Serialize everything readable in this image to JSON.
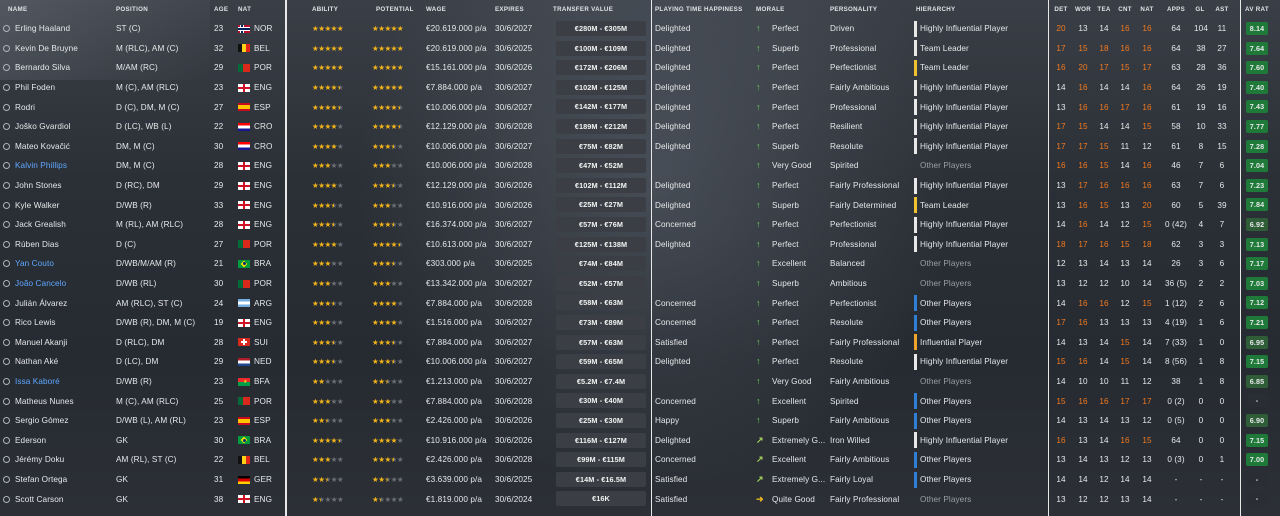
{
  "headers": {
    "name": "NAME",
    "position": "POSITION",
    "age": "AGE",
    "nat": "NAT",
    "ability": "ABILITY",
    "potential": "POTENTIAL",
    "wage": "WAGE",
    "expires": "EXPIRES",
    "transfer_value": "TRANSFER VALUE",
    "pt_happiness": "PLAYING TIME HAPPINESS",
    "morale": "MORALE",
    "personality": "PERSONALITY",
    "hierarchy": "HIERARCHY",
    "det": "DET",
    "wor": "WOR",
    "tea": "TEA",
    "cnt": "CNT",
    "natc": "NAT",
    "apps": "APPS",
    "gl": "GL",
    "ast": "AST",
    "avrat": "AV RAT"
  },
  "colors": {
    "star": "#f0b31a",
    "high_attr": "#f3791d",
    "link": "#5fa8ff",
    "hierarchy_white": "#e8e8e8",
    "hierarchy_yellow": "#f2c12e",
    "hierarchy_orange": "#f0a52a",
    "hierarchy_blue": "#2f7fd6",
    "rat_high": "#1f7a3a",
    "rat_mid": "#2f5d38"
  },
  "rows": [
    {
      "name": "Erling Haaland",
      "pos": "ST (C)",
      "age": "23",
      "flag": "NOR",
      "nat": "NOR",
      "ab": 5,
      "po": 5,
      "wage": "€20.619.000 p/a",
      "exp": "30/6/2027",
      "tv": "€280M - €305M",
      "pt": "Delighted",
      "mor": "Perfect",
      "mi": "up",
      "pers": "Driven",
      "hb": "white",
      "hier": "Highly Influential Player",
      "det": "20",
      "wor": "13",
      "tea": "14",
      "cnt": "16",
      "natc": "16",
      "apps": "64",
      "gl": "104",
      "ast": "11",
      "rat": "8.14"
    },
    {
      "name": "Kevin De Bruyne",
      "pos": "M (RLC), AM (C)",
      "age": "32",
      "flag": "BEL",
      "nat": "BEL",
      "ab": 5,
      "po": 5,
      "wage": "€20.619.000 p/a",
      "exp": "30/6/2025",
      "tv": "€100M - €109M",
      "pt": "Delighted",
      "mor": "Superb",
      "mi": "up",
      "pers": "Professional",
      "hb": "white",
      "hier": "Team Leader",
      "det": "17",
      "wor": "15",
      "tea": "18",
      "cnt": "16",
      "natc": "16",
      "apps": "64",
      "gl": "38",
      "ast": "27",
      "rat": "7.64"
    },
    {
      "name": "Bernardo Silva",
      "pos": "M/AM (RC)",
      "age": "29",
      "flag": "POR",
      "nat": "POR",
      "ab": 5,
      "po": 5,
      "wage": "€15.161.000 p/a",
      "exp": "30/6/2026",
      "tv": "€172M - €206M",
      "pt": "Delighted",
      "mor": "Perfect",
      "mi": "up",
      "pers": "Perfectionist",
      "hb": "yellow",
      "hier": "Team Leader",
      "det": "16",
      "wor": "20",
      "tea": "17",
      "cnt": "15",
      "natc": "17",
      "apps": "63",
      "gl": "28",
      "ast": "36",
      "rat": "7.60"
    },
    {
      "name": "Phil Foden",
      "pos": "M (C), AM (RLC)",
      "age": "23",
      "flag": "ENG",
      "nat": "ENG",
      "ab": 4.5,
      "po": 5,
      "wage": "€7.884.000 p/a",
      "exp": "30/6/2027",
      "tv": "€102M - €125M",
      "pt": "Delighted",
      "mor": "Perfect",
      "mi": "up",
      "pers": "Fairly Ambitious",
      "hb": "white",
      "hier": "Highly Influential Player",
      "det": "14",
      "wor": "16",
      "tea": "14",
      "cnt": "14",
      "natc": "16",
      "apps": "64",
      "gl": "26",
      "ast": "19",
      "rat": "7.40"
    },
    {
      "name": "Rodri",
      "pos": "D (C), DM, M (C)",
      "age": "27",
      "flag": "ESP",
      "nat": "ESP",
      "ab": 4.5,
      "po": 4.5,
      "wage": "€10.006.000 p/a",
      "exp": "30/6/2027",
      "tv": "€142M - €177M",
      "pt": "Delighted",
      "mor": "Perfect",
      "mi": "up",
      "pers": "Professional",
      "hb": "white",
      "hier": "Highly Influential Player",
      "det": "13",
      "wor": "16",
      "tea": "16",
      "cnt": "17",
      "natc": "16",
      "apps": "61",
      "gl": "19",
      "ast": "16",
      "rat": "7.43"
    },
    {
      "name": "Joško Gvardiol",
      "pos": "D (LC), WB (L)",
      "age": "22",
      "flag": "CRO",
      "nat": "CRO",
      "ab": 4,
      "po": 4.5,
      "wage": "€12.129.000 p/a",
      "exp": "30/6/2028",
      "tv": "€189M - €212M",
      "pt": "Delighted",
      "mor": "Perfect",
      "mi": "up",
      "pers": "Resilient",
      "hb": "white",
      "hier": "Highly Influential Player",
      "det": "17",
      "wor": "15",
      "tea": "14",
      "cnt": "14",
      "natc": "15",
      "apps": "58",
      "gl": "10",
      "ast": "33",
      "rat": "7.77"
    },
    {
      "name": "Mateo Kovačić",
      "pos": "DM, M (C)",
      "age": "30",
      "flag": "CRO",
      "nat": "CRO",
      "ab": 4,
      "po": 3.5,
      "wage": "€10.006.000 p/a",
      "exp": "30/6/2027",
      "tv": "€75M - €82M",
      "pt": "Delighted",
      "mor": "Superb",
      "mi": "up",
      "pers": "Resolute",
      "hb": "white",
      "hier": "Highly Influential Player",
      "det": "17",
      "wor": "17",
      "tea": "15",
      "cnt": "11",
      "natc": "12",
      "apps": "61",
      "gl": "8",
      "ast": "15",
      "rat": "7.28"
    },
    {
      "name": "Kalvin Phillips",
      "pos": "DM, M (C)",
      "age": "28",
      "flag": "ENG",
      "nat": "ENG",
      "link": true,
      "ab": 3,
      "po": 3,
      "wage": "€10.006.000 p/a",
      "exp": "30/6/2028",
      "tv": "€47M - €52M",
      "pt": "",
      "mor": "Very Good",
      "mi": "up",
      "pers": "Spirited",
      "hb": "",
      "hier": "Other Players",
      "dimh": true,
      "det": "16",
      "wor": "16",
      "tea": "15",
      "cnt": "14",
      "natc": "16",
      "apps": "46",
      "gl": "7",
      "ast": "6",
      "rat": "7.04"
    },
    {
      "name": "John Stones",
      "pos": "D (RC), DM",
      "age": "29",
      "flag": "ENG",
      "nat": "ENG",
      "ab": 4,
      "po": 3.5,
      "wage": "€12.129.000 p/a",
      "exp": "30/6/2026",
      "tv": "€102M - €112M",
      "pt": "Delighted",
      "mor": "Perfect",
      "mi": "up",
      "pers": "Fairly Professional",
      "hb": "white",
      "hier": "Highly Influential Player",
      "det": "13",
      "wor": "17",
      "tea": "16",
      "cnt": "16",
      "natc": "16",
      "apps": "63",
      "gl": "7",
      "ast": "6",
      "rat": "7.23"
    },
    {
      "name": "Kyle Walker",
      "pos": "D/WB (R)",
      "age": "33",
      "flag": "ENG",
      "nat": "ENG",
      "ab": 3.5,
      "po": 3,
      "wage": "€10.916.000 p/a",
      "exp": "30/6/2026",
      "tv": "€25M - €27M",
      "pt": "Delighted",
      "mor": "Superb",
      "mi": "up",
      "pers": "Fairly Determined",
      "hb": "yellow",
      "hier": "Team Leader",
      "det": "13",
      "wor": "16",
      "tea": "15",
      "cnt": "13",
      "natc": "20",
      "apps": "60",
      "gl": "5",
      "ast": "39",
      "rat": "7.84"
    },
    {
      "name": "Jack Grealish",
      "pos": "M (RL), AM (RLC)",
      "age": "28",
      "flag": "ENG",
      "nat": "ENG",
      "ab": 3.5,
      "po": 3.5,
      "wage": "€16.374.000 p/a",
      "exp": "30/6/2027",
      "tv": "€57M - €76M",
      "pt": "Concerned",
      "mor": "Perfect",
      "mi": "up",
      "pers": "Perfectionist",
      "hb": "white",
      "hier": "Highly Influential Player",
      "det": "14",
      "wor": "16",
      "tea": "14",
      "cnt": "12",
      "natc": "15",
      "apps": "0 (42)",
      "gl": "4",
      "ast": "7",
      "rat": "6.92"
    },
    {
      "name": "Rúben Dias",
      "pos": "D (C)",
      "age": "27",
      "flag": "POR",
      "nat": "POR",
      "ab": 4,
      "po": 4.5,
      "wage": "€10.613.000 p/a",
      "exp": "30/6/2027",
      "tv": "€125M - €138M",
      "pt": "Delighted",
      "mor": "Perfect",
      "mi": "up",
      "pers": "Professional",
      "hb": "white",
      "hier": "Highly Influential Player",
      "det": "18",
      "wor": "17",
      "tea": "16",
      "cnt": "15",
      "natc": "18",
      "apps": "62",
      "gl": "3",
      "ast": "3",
      "rat": "7.13"
    },
    {
      "name": "Yan Couto",
      "pos": "D/WB/M/AM (R)",
      "age": "21",
      "flag": "BRA",
      "nat": "BRA",
      "link": true,
      "ab": 3,
      "po": 3.5,
      "wage": "€303.000 p/a",
      "exp": "30/6/2025",
      "tv": "€74M - €84M",
      "pt": "",
      "mor": "Excellent",
      "mi": "up",
      "pers": "Balanced",
      "hb": "",
      "hier": "Other Players",
      "dimh": true,
      "det": "12",
      "wor": "13",
      "tea": "14",
      "cnt": "13",
      "natc": "14",
      "apps": "26",
      "gl": "3",
      "ast": "6",
      "rat": "7.17"
    },
    {
      "name": "João Cancelo",
      "pos": "D/WB (RL)",
      "age": "30",
      "flag": "POR",
      "nat": "POR",
      "link": true,
      "ab": 3,
      "po": 3,
      "wage": "€13.342.000 p/a",
      "exp": "30/6/2027",
      "tv": "€52M - €57M",
      "pt": "",
      "mor": "Superb",
      "mi": "up",
      "pers": "Ambitious",
      "hb": "",
      "hier": "Other Players",
      "dimh": true,
      "det": "13",
      "wor": "12",
      "tea": "12",
      "cnt": "10",
      "natc": "14",
      "apps": "36 (5)",
      "gl": "2",
      "ast": "2",
      "rat": "7.03"
    },
    {
      "name": "Julián Álvarez",
      "pos": "AM (RLC), ST (C)",
      "age": "24",
      "flag": "ARG",
      "nat": "ARG",
      "ab": 3.5,
      "po": 4,
      "wage": "€7.884.000 p/a",
      "exp": "30/6/2028",
      "tv": "€58M - €63M",
      "pt": "Concerned",
      "mor": "Perfect",
      "mi": "up",
      "pers": "Perfectionist",
      "hb": "blue",
      "hier": "Other Players",
      "det": "14",
      "wor": "16",
      "tea": "16",
      "cnt": "12",
      "natc": "15",
      "apps": "1 (12)",
      "gl": "2",
      "ast": "6",
      "rat": "7.12"
    },
    {
      "name": "Rico Lewis",
      "pos": "D/WB (R), DM, M (C)",
      "age": "19",
      "flag": "ENG",
      "nat": "ENG",
      "ab": 3,
      "po": 4,
      "wage": "€1.516.000 p/a",
      "exp": "30/6/2027",
      "tv": "€73M - €89M",
      "pt": "Concerned",
      "mor": "Perfect",
      "mi": "up",
      "pers": "Resolute",
      "hb": "blue",
      "hier": "Other Players",
      "det": "17",
      "wor": "16",
      "tea": "13",
      "cnt": "13",
      "natc": "13",
      "apps": "4 (19)",
      "gl": "1",
      "ast": "6",
      "rat": "7.21"
    },
    {
      "name": "Manuel Akanji",
      "pos": "D (RLC), DM",
      "age": "28",
      "flag": "SUI",
      "nat": "SUI",
      "ab": 3.5,
      "po": 3.5,
      "wage": "€7.884.000 p/a",
      "exp": "30/6/2027",
      "tv": "€57M - €63M",
      "pt": "Satisfied",
      "mor": "Perfect",
      "mi": "up",
      "pers": "Fairly Professional",
      "hb": "orange",
      "hier": "Influential Player",
      "det": "14",
      "wor": "13",
      "tea": "14",
      "cnt": "15",
      "natc": "14",
      "apps": "7 (33)",
      "gl": "1",
      "ast": "0",
      "rat": "6.95"
    },
    {
      "name": "Nathan Aké",
      "pos": "D (LC), DM",
      "age": "29",
      "flag": "NED",
      "nat": "NED",
      "ab": 3.5,
      "po": 3.5,
      "wage": "€10.006.000 p/a",
      "exp": "30/6/2027",
      "tv": "€59M - €65M",
      "pt": "Delighted",
      "mor": "Perfect",
      "mi": "up",
      "pers": "Resolute",
      "hb": "white",
      "hier": "Highly Influential Player",
      "det": "15",
      "wor": "16",
      "tea": "14",
      "cnt": "15",
      "natc": "14",
      "apps": "8 (56)",
      "gl": "1",
      "ast": "8",
      "rat": "7.15"
    },
    {
      "name": "Issa Kaboré",
      "pos": "D/WB (R)",
      "age": "23",
      "flag": "BFA",
      "nat": "BFA",
      "link": true,
      "ab": 2,
      "po": 2.5,
      "wage": "€1.213.000 p/a",
      "exp": "30/6/2027",
      "tv": "€5.2M - €7.4M",
      "pt": "",
      "mor": "Very Good",
      "mi": "up",
      "pers": "Fairly Ambitious",
      "hb": "",
      "hier": "Other Players",
      "dimh": true,
      "det": "14",
      "wor": "10",
      "tea": "10",
      "cnt": "11",
      "natc": "12",
      "apps": "38",
      "gl": "1",
      "ast": "8",
      "rat": "6.85"
    },
    {
      "name": "Matheus Nunes",
      "pos": "M (C), AM (RLC)",
      "age": "25",
      "flag": "POR",
      "nat": "POR",
      "ab": 3,
      "po": 3,
      "wage": "€7.884.000 p/a",
      "exp": "30/6/2028",
      "tv": "€30M - €40M",
      "pt": "Concerned",
      "mor": "Excellent",
      "mi": "up",
      "pers": "Spirited",
      "hb": "blue",
      "hier": "Other Players",
      "det": "15",
      "wor": "16",
      "tea": "16",
      "cnt": "17",
      "natc": "17",
      "apps": "0 (2)",
      "gl": "0",
      "ast": "0",
      "rat": "-"
    },
    {
      "name": "Sergio Gómez",
      "pos": "D/WB (L), AM (RL)",
      "age": "23",
      "flag": "ESP",
      "nat": "ESP",
      "ab": 2.5,
      "po": 3,
      "wage": "€2.426.000 p/a",
      "exp": "30/6/2026",
      "tv": "€25M - €30M",
      "pt": "Happy",
      "mor": "Superb",
      "mi": "up",
      "pers": "Fairly Ambitious",
      "hb": "blue",
      "hier": "Other Players",
      "det": "14",
      "wor": "13",
      "tea": "14",
      "cnt": "13",
      "natc": "12",
      "apps": "0 (5)",
      "gl": "0",
      "ast": "0",
      "rat": "6.90"
    },
    {
      "name": "Ederson",
      "pos": "GK",
      "age": "30",
      "flag": "BRA",
      "nat": "BRA",
      "ab": 4.5,
      "po": 4,
      "wage": "€10.916.000 p/a",
      "exp": "30/6/2026",
      "tv": "€116M - €127M",
      "pt": "Delighted",
      "mor": "Extremely G...",
      "mi": "diag",
      "pers": "Iron Willed",
      "hb": "white",
      "hier": "Highly Influential Player",
      "det": "16",
      "wor": "13",
      "tea": "14",
      "cnt": "16",
      "natc": "15",
      "apps": "64",
      "gl": "0",
      "ast": "0",
      "rat": "7.15"
    },
    {
      "name": "Jérémy Doku",
      "pos": "AM (RL), ST (C)",
      "age": "22",
      "flag": "BEL",
      "nat": "BEL",
      "ab": 3,
      "po": 3.5,
      "wage": "€2.426.000 p/a",
      "exp": "30/6/2028",
      "tv": "€99M - €115M",
      "pt": "Concerned",
      "mor": "Excellent",
      "mi": "diag",
      "pers": "Fairly Ambitious",
      "hb": "blue",
      "hier": "Other Players",
      "det": "13",
      "wor": "14",
      "tea": "13",
      "cnt": "12",
      "natc": "13",
      "apps": "0 (3)",
      "gl": "0",
      "ast": "1",
      "rat": "7.00"
    },
    {
      "name": "Stefan Ortega",
      "pos": "GK",
      "age": "31",
      "flag": "GER",
      "nat": "GER",
      "ab": 2.5,
      "po": 2.5,
      "wage": "€3.639.000 p/a",
      "exp": "30/6/2025",
      "tv": "€14M - €16.5M",
      "pt": "Satisfied",
      "mor": "Extremely G...",
      "mi": "diag",
      "pers": "Fairly Loyal",
      "hb": "blue",
      "hier": "Other Players",
      "det": "14",
      "wor": "14",
      "tea": "12",
      "cnt": "14",
      "natc": "14",
      "apps": "-",
      "gl": "-",
      "ast": "-",
      "rat": "-"
    },
    {
      "name": "Scott Carson",
      "pos": "GK",
      "age": "38",
      "flag": "ENG",
      "nat": "ENG",
      "ab": 1.5,
      "po": 1.5,
      "wage": "€1.819.000 p/a",
      "exp": "30/6/2024",
      "tv": "€16K",
      "pt": "Satisfied",
      "mor": "Quite Good",
      "mi": "side",
      "pers": "Fairly Professional",
      "hb": "",
      "hier": "Other Players",
      "dimh": true,
      "det": "13",
      "wor": "12",
      "tea": "12",
      "cnt": "13",
      "natc": "14",
      "apps": "-",
      "gl": "-",
      "ast": "-",
      "rat": "-"
    }
  ]
}
